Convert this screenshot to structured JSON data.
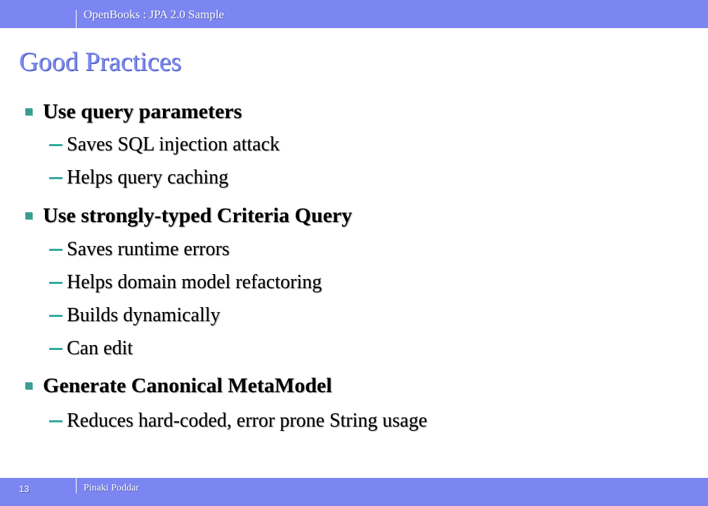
{
  "header": {
    "deck_title": "OpenBooks : JPA 2.0 Sample"
  },
  "slide": {
    "title": "Good Practices",
    "sections": [
      {
        "heading": "Use query parameters",
        "points": [
          "Saves SQL injection attack",
          "Helps query caching"
        ]
      },
      {
        "heading": "Use strongly-typed Criteria Query",
        "points": [
          "Saves runtime errors",
          "Helps domain model refactoring",
          "Builds dynamically",
          "Can edit"
        ]
      },
      {
        "heading": "Generate Canonical MetaModel",
        "points": [
          "Reduces hard-coded, error prone String usage"
        ]
      }
    ]
  },
  "footer": {
    "page_number": "13",
    "author": "Pinaki Poddar"
  },
  "colors": {
    "bar": "#7b86f2",
    "title": "#7f8cf0",
    "bullet": "#3a9c95",
    "dash": "#34a89e"
  }
}
